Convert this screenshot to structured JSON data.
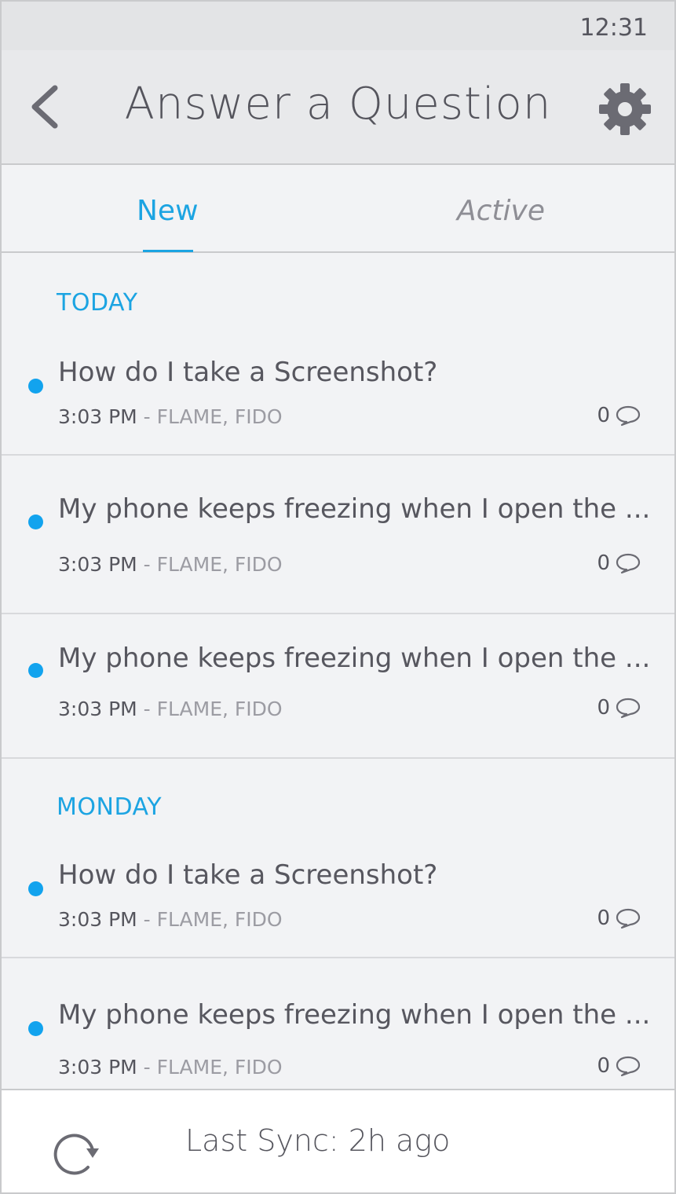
{
  "status_bar": {
    "time": "12:31"
  },
  "app_bar": {
    "title": "Answer a Question",
    "back_icon": "chevron-left-icon",
    "settings_icon": "gear-icon"
  },
  "tabs": [
    {
      "label": "New",
      "selected": true
    },
    {
      "label": "Active",
      "selected": false
    }
  ],
  "sections": [
    {
      "header": "TODAY",
      "items": [
        {
          "question": "How do I take a Screenshot?",
          "time": "3:03 PM",
          "separator": " - ",
          "tags": "FLAME, FIDO",
          "replies": "0"
        },
        {
          "question": "My phone keeps freezing when I open the ...",
          "time": "3:03 PM",
          "separator": " - ",
          "tags": "FLAME, FIDO",
          "replies": "0"
        },
        {
          "question": "My phone keeps freezing when I open the ...",
          "time": "3:03 PM",
          "separator": " - ",
          "tags": "FLAME, FIDO",
          "replies": "0"
        }
      ]
    },
    {
      "header": "MONDAY",
      "items": [
        {
          "question": "How do I take a Screenshot?",
          "time": "3:03 PM",
          "separator": " - ",
          "tags": "FLAME, FIDO",
          "replies": "0"
        },
        {
          "question": "My phone keeps freezing when I open the ...",
          "time": "3:03 PM",
          "separator": " - ",
          "tags": "FLAME, FIDO",
          "replies": "0"
        }
      ]
    }
  ],
  "footer": {
    "sync_label": "Last Sync: 2h ago",
    "sync_icon": "refresh-icon"
  },
  "colors": {
    "accent": "#1ca4e2",
    "unread_dot": "#12a3ee",
    "text": "#57575f",
    "muted": "#9c9ca3"
  }
}
